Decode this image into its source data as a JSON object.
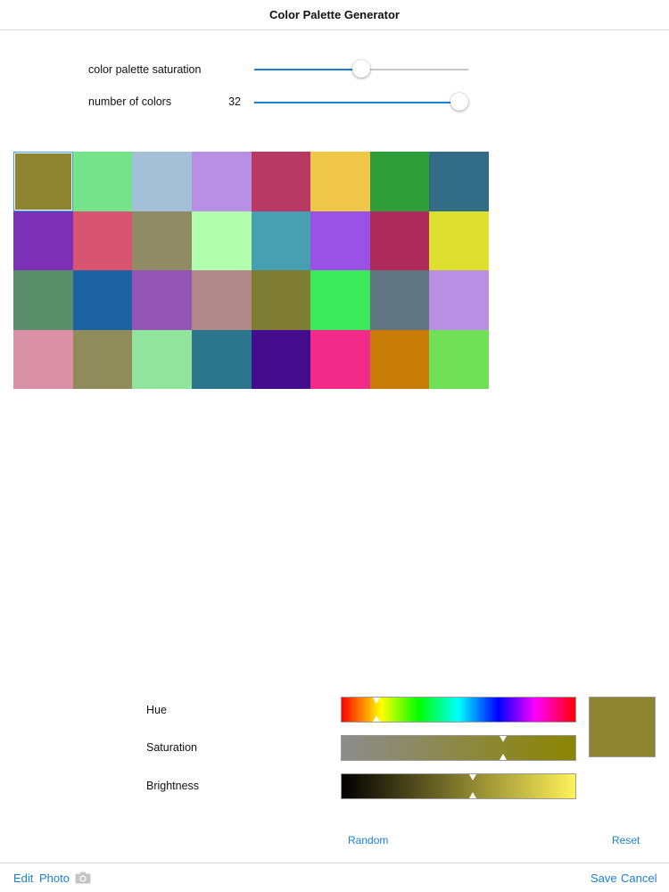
{
  "window": {
    "title": "Color Palette Generator"
  },
  "controls": {
    "saturation": {
      "label": "color palette saturation",
      "value": 0.5
    },
    "count": {
      "label": "number of colors",
      "value_text": "32",
      "value": 1.0
    }
  },
  "palette": {
    "columns": 8,
    "selected_index": 0,
    "colors": [
      "#8d8530",
      "#74e38a",
      "#a3c0d6",
      "#b78fe3",
      "#b83a64",
      "#f0c748",
      "#2f9e3a",
      "#336c86",
      "#7c31b6",
      "#d95471",
      "#8f8c65",
      "#b3fdaf",
      "#489fb1",
      "#9951e6",
      "#ad2a5a",
      "#dee02f",
      "#5b8f6c",
      "#1c62a3",
      "#9355b3",
      "#b1888a",
      "#7f7c33",
      "#3ce95a",
      "#607683",
      "#b88fe3",
      "#da90a6",
      "#8f8b5a",
      "#92e39e",
      "#2b758d",
      "#430d8e",
      "#f22b8a",
      "#c97b08",
      "#70e157"
    ]
  },
  "editor": {
    "hue": {
      "label": "Hue",
      "value": 0.15
    },
    "saturation": {
      "label": "Saturation",
      "value": 0.69
    },
    "brightness": {
      "label": "Brightness",
      "value": 0.56
    },
    "preview_color": "#8d8530",
    "random_label": "Random",
    "reset_label": "Reset"
  },
  "toolbar": {
    "edit_label": "Edit",
    "photo_label": "Photo",
    "camera_icon": "camera-icon",
    "save_label": "Save",
    "cancel_label": "Cancel"
  },
  "colors": {
    "accent": "#1a7fd6",
    "selection": "#3aa0e8"
  }
}
